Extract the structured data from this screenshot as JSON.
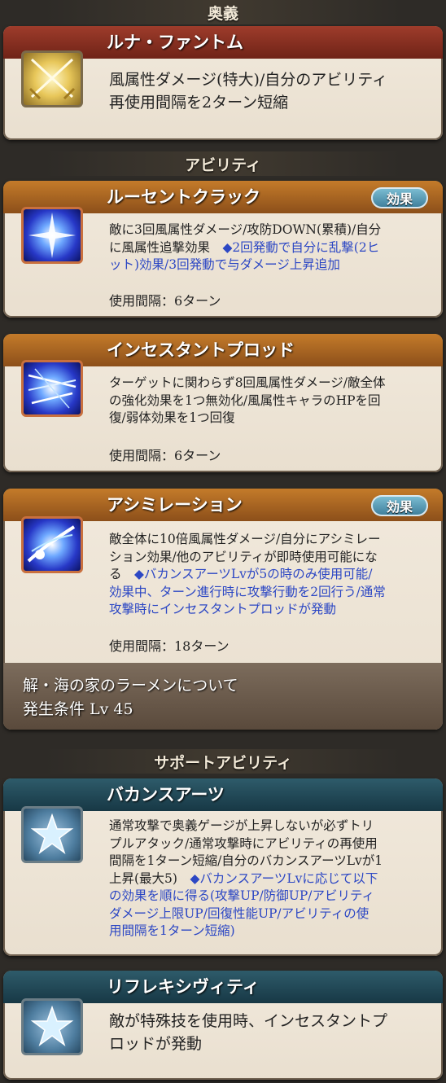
{
  "sections": {
    "ougi": "奥義",
    "ability": "アビリティ",
    "support": "サポートアビリティ"
  },
  "ougi": {
    "name": "ルナ・ファントム",
    "desc_line1": "風属性ダメージ(特大)/自分のアビリティ",
    "desc_line2": "再使用間隔を2ターン短縮",
    "icon": "crossed-swords-icon"
  },
  "abilities": [
    {
      "name": "ルーセントクラック",
      "badge": "効果",
      "desc_l1": "敵に3回風属性ダメージ/攻防DOWN(累積)/自分",
      "desc_l2a": "に風属性追撃効果　",
      "desc_l2b": "◆2回発動で自分に乱撃(2ヒ",
      "desc_l3": "ット)効果/3回発動で与ダメージ上昇追加",
      "cooldown": "使用間隔：6ターン",
      "icon": "light-burst-icon"
    },
    {
      "name": "インセスタントプロッド",
      "desc_l1": "ターゲットに関わらず8回風属性ダメージ/敵全体",
      "desc_l2": "の強化効果を1つ無効化/風属性キャラのHPを回",
      "desc_l3": "復/弱体効果を1つ回復",
      "cooldown": "使用間隔：6ターン",
      "icon": "multi-slash-icon"
    },
    {
      "name": "アシミレーション",
      "badge": "効果",
      "desc_l1": "敵全体に10倍風属性ダメージ/自分にアシミレー",
      "desc_l2": "ション効果/他のアビリティが即時使用可能にな",
      "desc_l3a": "る　",
      "desc_l3b": "◆バカンスアーツLvが5の時のみ使用可能/",
      "desc_l4": "効果中、ターン進行時に攻撃行動を2回行う/通常",
      "desc_l5": "攻撃時にインセスタントプロッドが発動",
      "cooldown": "使用間隔：18ターン",
      "icon": "comet-strike-icon"
    }
  ],
  "unlock": {
    "line1": "解・海の家のラーメンについて",
    "line2": "発生条件 Lv 45"
  },
  "supports": [
    {
      "name": "バカンスアーツ",
      "desc_l1": "通常攻撃で奥義ゲージが上昇しないが必ずトリ",
      "desc_l2": "プルアタック/通常攻撃時にアビリティの再使用",
      "desc_l3": "間隔を1ターン短縮/自分のバカンスアーツLvが1",
      "desc_l4a": "上昇(最大5)　",
      "desc_l4b": "◆バカンスアーツLvに応じて以下",
      "desc_l5": "の効果を順に得る(攻撃UP/防御UP/アビリティ",
      "desc_l6": "ダメージ上限UP/回復性能UP/アビリティの使",
      "desc_l7": "用間隔を1ターン短縮)",
      "icon": "star-icon"
    },
    {
      "name": "リフレキシヴィティ",
      "desc_l1": "敵が特殊技を使用時、インセスタントプ",
      "desc_l2": "ロッドが発動",
      "icon": "star-icon"
    }
  ],
  "colors": {
    "ougi_title": "#9e3c2b",
    "ability_title": "#c47b2a",
    "support_title": "#2e5b6a",
    "note_text": "#2c47c4"
  }
}
